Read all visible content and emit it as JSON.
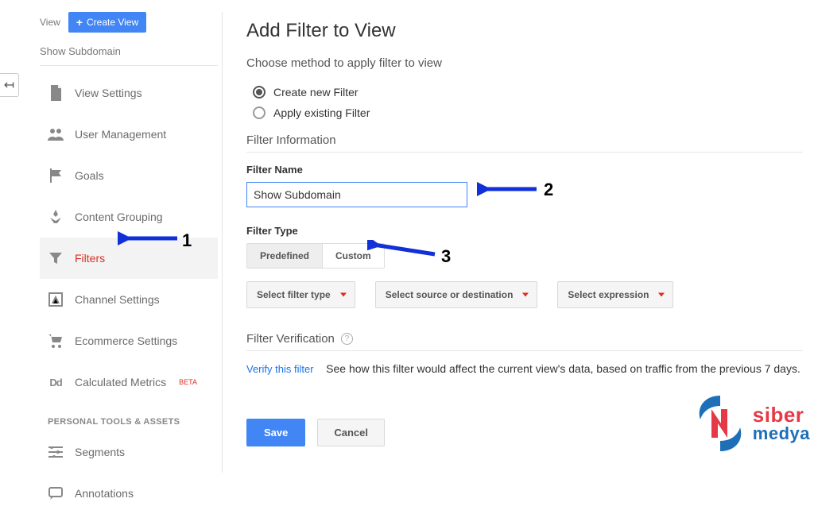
{
  "sidebar": {
    "view_label": "View",
    "create_view_label": "Create View",
    "subdomain_text": "Show Subdomain",
    "items": [
      {
        "label": "View Settings"
      },
      {
        "label": "User Management"
      },
      {
        "label": "Goals"
      },
      {
        "label": "Content Grouping"
      },
      {
        "label": "Filters"
      },
      {
        "label": "Channel Settings"
      },
      {
        "label": "Ecommerce Settings"
      },
      {
        "label": "Calculated Metrics",
        "beta": "BETA"
      }
    ],
    "personal_heading": "PERSONAL TOOLS & ASSETS",
    "personal_items": [
      {
        "label": "Segments"
      },
      {
        "label": "Annotations"
      }
    ]
  },
  "main": {
    "title": "Add Filter to View",
    "choose_method": "Choose method to apply filter to view",
    "radio_create": "Create new Filter",
    "radio_apply": "Apply existing Filter",
    "filter_info_heading": "Filter Information",
    "filter_name_label": "Filter Name",
    "filter_name_value": "Show Subdomain",
    "filter_type_label": "Filter Type",
    "tab_predefined": "Predefined",
    "tab_custom": "Custom",
    "select_filter_type": "Select filter type",
    "select_source": "Select source or destination",
    "select_expression": "Select expression",
    "verification_heading": "Filter Verification",
    "verify_link": "Verify this filter",
    "verify_desc": "See how this filter would affect the current view's data, based on traffic from the previous 7 days.",
    "save_label": "Save",
    "cancel_label": "Cancel"
  },
  "annotations": {
    "a1": "1",
    "a2": "2",
    "a3": "3"
  },
  "logo": {
    "line1": "siber",
    "line2": "medya"
  }
}
